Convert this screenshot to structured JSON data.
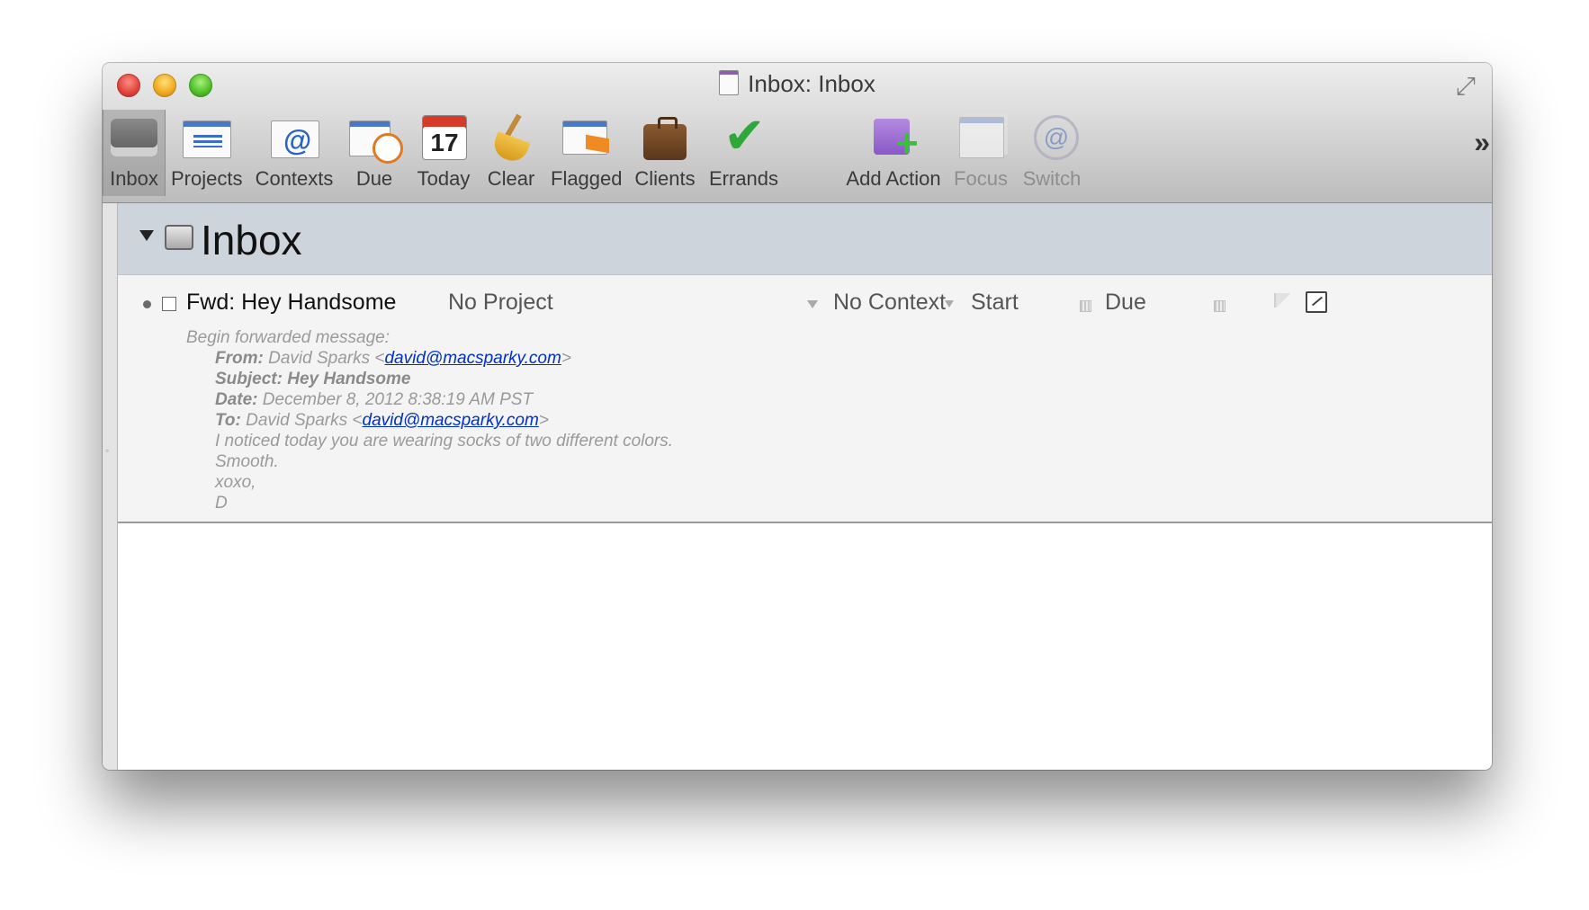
{
  "window": {
    "title": "Inbox: Inbox"
  },
  "toolbar": {
    "items": [
      {
        "label": "Inbox",
        "icon": "inbox-icon"
      },
      {
        "label": "Projects",
        "icon": "projects-icon"
      },
      {
        "label": "Contexts",
        "icon": "contexts-icon"
      },
      {
        "label": "Due",
        "icon": "due-clock-icon"
      },
      {
        "label": "Today",
        "icon": "calendar-today-icon"
      },
      {
        "label": "Clear",
        "icon": "broom-icon"
      },
      {
        "label": "Flagged",
        "icon": "flag-icon"
      },
      {
        "label": "Clients",
        "icon": "briefcase-icon"
      },
      {
        "label": "Errands",
        "icon": "checkmark-icon"
      },
      {
        "label": "Add Action",
        "icon": "add-action-icon"
      },
      {
        "label": "Focus",
        "icon": "focus-icon"
      },
      {
        "label": "Switch",
        "icon": "switch-icon"
      }
    ],
    "overflow": "»"
  },
  "section": {
    "title": "Inbox"
  },
  "task": {
    "title": "Fwd: Hey Handsome",
    "project": "No Project",
    "context": "No Context",
    "start": "Start",
    "due": "Due",
    "note": {
      "intro": "Begin forwarded message:",
      "from_label": "From:",
      "from_name": " David Sparks <",
      "from_email": "david@macsparky.com",
      "from_close": ">",
      "subject_label": "Subject: Hey Handsome",
      "date_label": "Date:",
      "date_value": " December 8, 2012 8:38:19 AM PST",
      "to_label": "To:",
      "to_name": " David Sparks <",
      "to_email": "david@macsparky.com",
      "to_close": ">",
      "line1": "I noticed today you are wearing socks of two different colors.",
      "line2": "Smooth.",
      "line3": "xoxo,",
      "line4": "D"
    }
  },
  "colors": {
    "header_bg": "#cdd4dc",
    "link": "#0030c8",
    "note_text": "#9a9a9a"
  }
}
